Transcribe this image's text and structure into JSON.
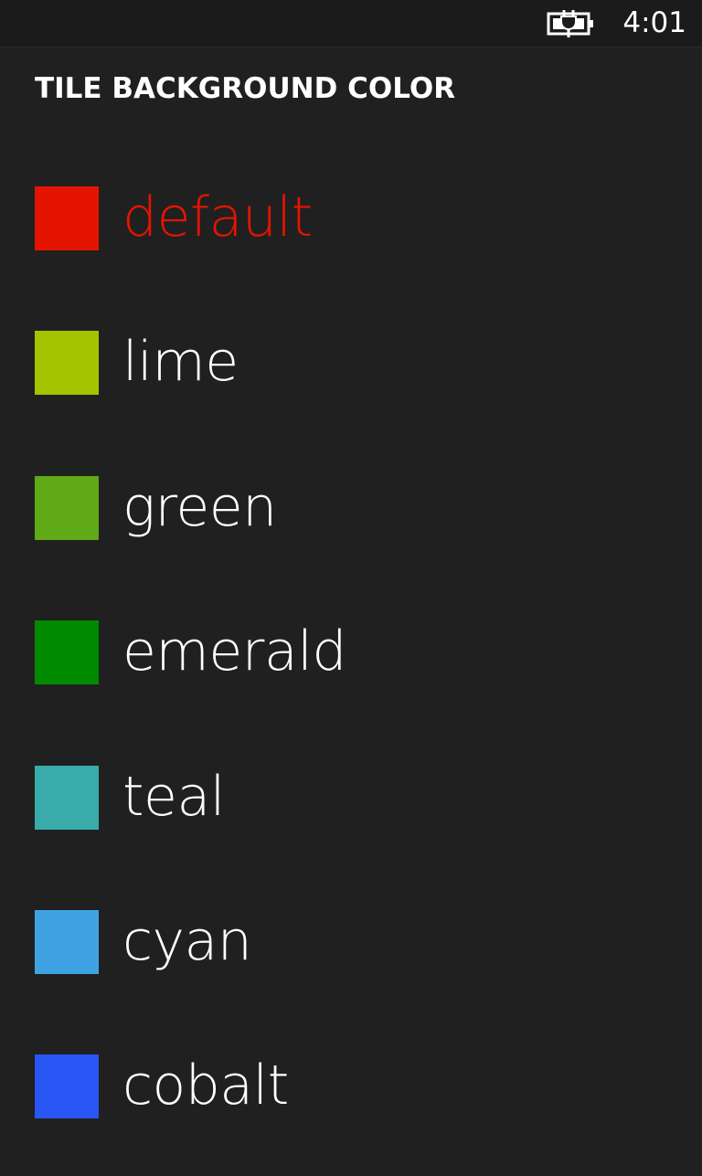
{
  "status_bar": {
    "time": "4:01",
    "battery_icon": "battery-charging-icon"
  },
  "page": {
    "title": "TILE BACKGROUND COLOR"
  },
  "colors": [
    {
      "name": "default",
      "hex": "#e51400",
      "selected": true
    },
    {
      "name": "lime",
      "hex": "#a4c400",
      "selected": false
    },
    {
      "name": "green",
      "hex": "#60a917",
      "selected": false
    },
    {
      "name": "emerald",
      "hex": "#008a00",
      "selected": false
    },
    {
      "name": "teal",
      "hex": "#3aabab",
      "selected": false
    },
    {
      "name": "cyan",
      "hex": "#3fa3e3",
      "selected": false
    },
    {
      "name": "cobalt",
      "hex": "#2a55f5",
      "selected": false
    }
  ]
}
